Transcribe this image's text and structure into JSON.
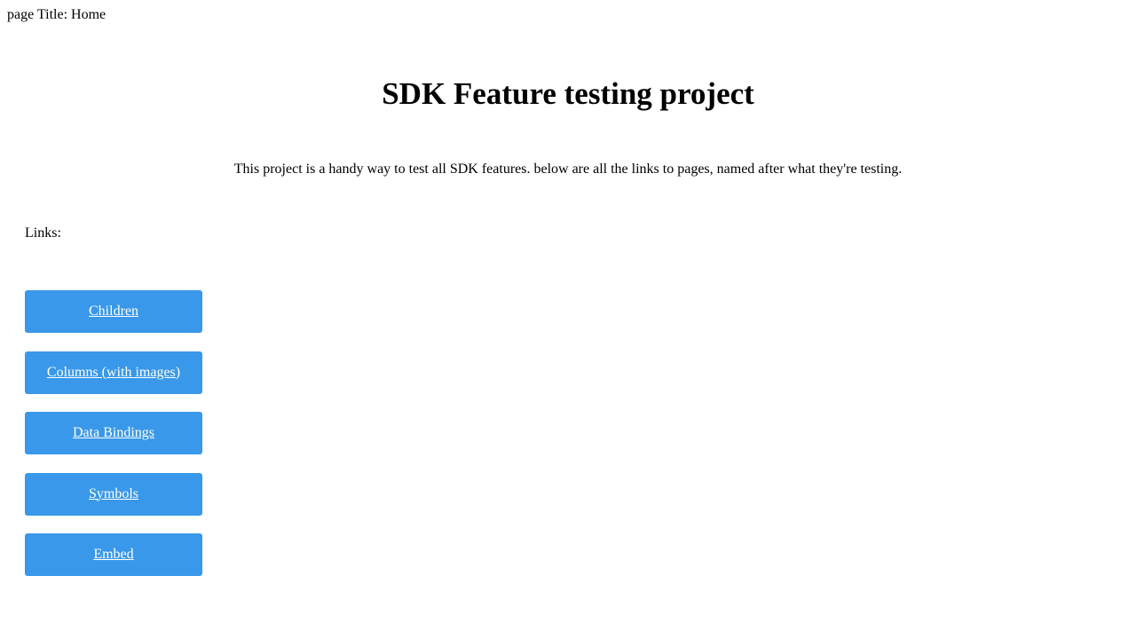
{
  "page_title_line": "page Title: Home",
  "heading": "SDK Feature testing project",
  "intro": "This project is a handy way to test all SDK features. below are all the links to pages, named after what they're testing.",
  "links_label": "Links:",
  "links": [
    {
      "label": "Children"
    },
    {
      "label": "Columns (with images)"
    },
    {
      "label": "Data Bindings"
    },
    {
      "label": "Symbols"
    },
    {
      "label": "Embed"
    }
  ],
  "colors": {
    "button_bg": "#3998e9",
    "button_text": "#ffffff"
  }
}
